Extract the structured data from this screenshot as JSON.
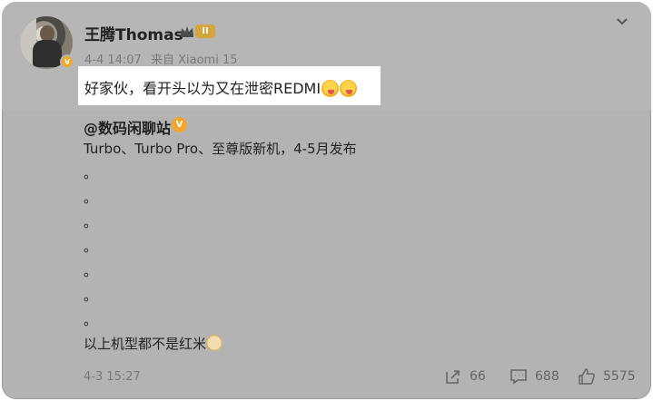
{
  "post": {
    "username": "王腾Thomas",
    "level_badge": "II",
    "meta": {
      "time": "4-4 14:07",
      "source": "来自 Xiaomi 15"
    },
    "text": "好家伙，看开头以为又在泄密REDMI"
  },
  "repost": {
    "author": "@数码闲聊站",
    "verified_label": "V",
    "lines": [
      "Turbo、Turbo Pro、至尊版新机，4-5月发布",
      "。",
      "。",
      "。",
      "。",
      "。",
      "。",
      "。",
      "以上机型都不是红米"
    ]
  },
  "footer": {
    "timestamp": "4-3 15:27",
    "repost_count": "66",
    "comment_count": "688",
    "like_count": "5575"
  },
  "icons": [
    "avatar",
    "crown-icon",
    "chevron-down-icon",
    "laughing-emoji",
    "doge-emoji",
    "share-icon",
    "comment-icon",
    "like-icon"
  ],
  "colors": {
    "card_background": "#b3b3b3",
    "highlight": "#ffffff",
    "verified_orange": "#f2a62b",
    "muted_text": "#7a7a7a"
  }
}
